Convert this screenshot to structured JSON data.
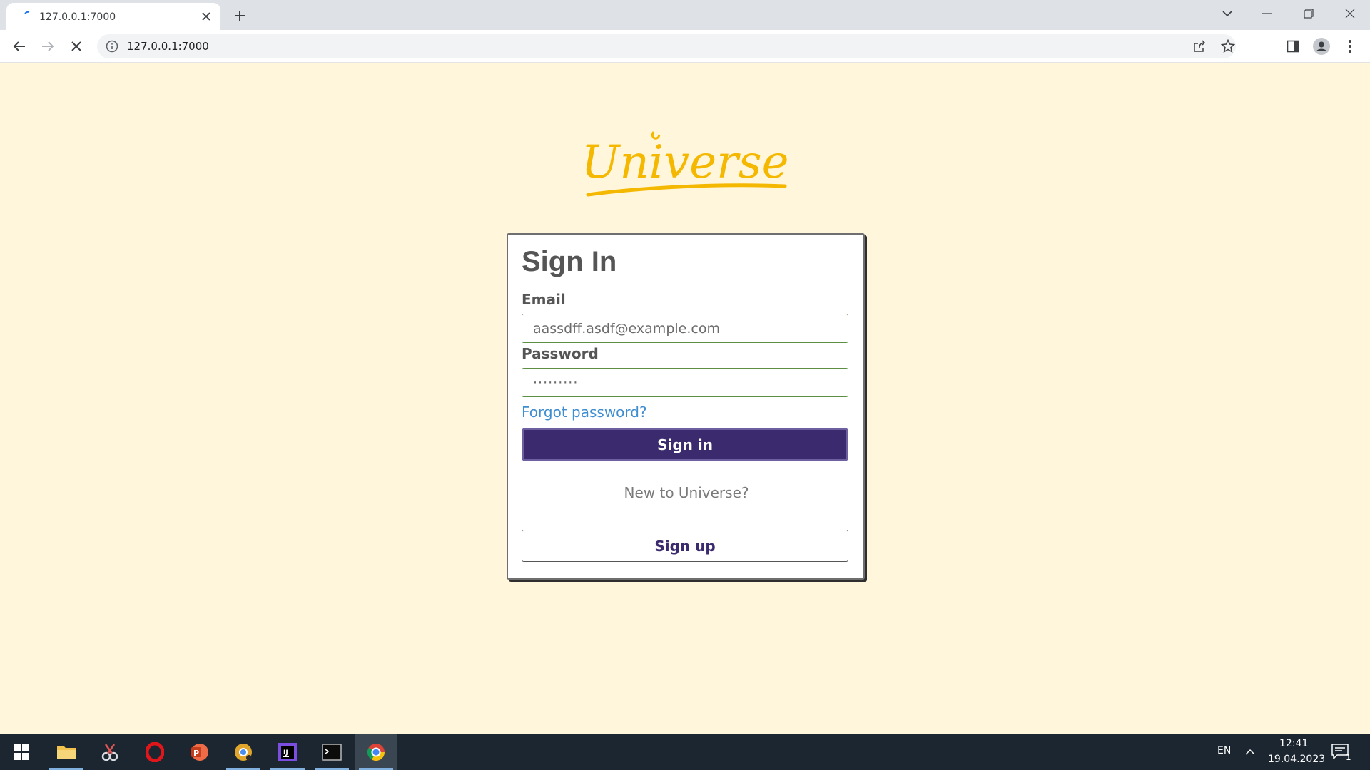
{
  "browser": {
    "tab_title": "127.0.0.1:7000",
    "url": "127.0.0.1:7000"
  },
  "page": {
    "logo_text": "Universe",
    "logo_color": "#f5b800",
    "background": "#fff6dc"
  },
  "signin": {
    "title": "Sign In",
    "email_label": "Email",
    "email_value": "aassdff.asdf@example.com",
    "password_label": "Password",
    "password_value": "·········",
    "forgot_link": "Forgot password?",
    "signin_button": "Sign in",
    "divider_text": "New to Universe?",
    "signup_button": "Sign up",
    "accent_color": "#3b2a6e",
    "link_color": "#3f8ed1"
  },
  "taskbar": {
    "language": "EN",
    "time": "12:41",
    "date": "19.04.2023",
    "notification_count": "1",
    "apps": [
      "file-explorer-icon",
      "snipping-tool-icon",
      "opera-icon",
      "powerpoint-icon",
      "chrome-canary-icon",
      "intellij-icon",
      "terminal-icon",
      "chrome-icon"
    ]
  }
}
